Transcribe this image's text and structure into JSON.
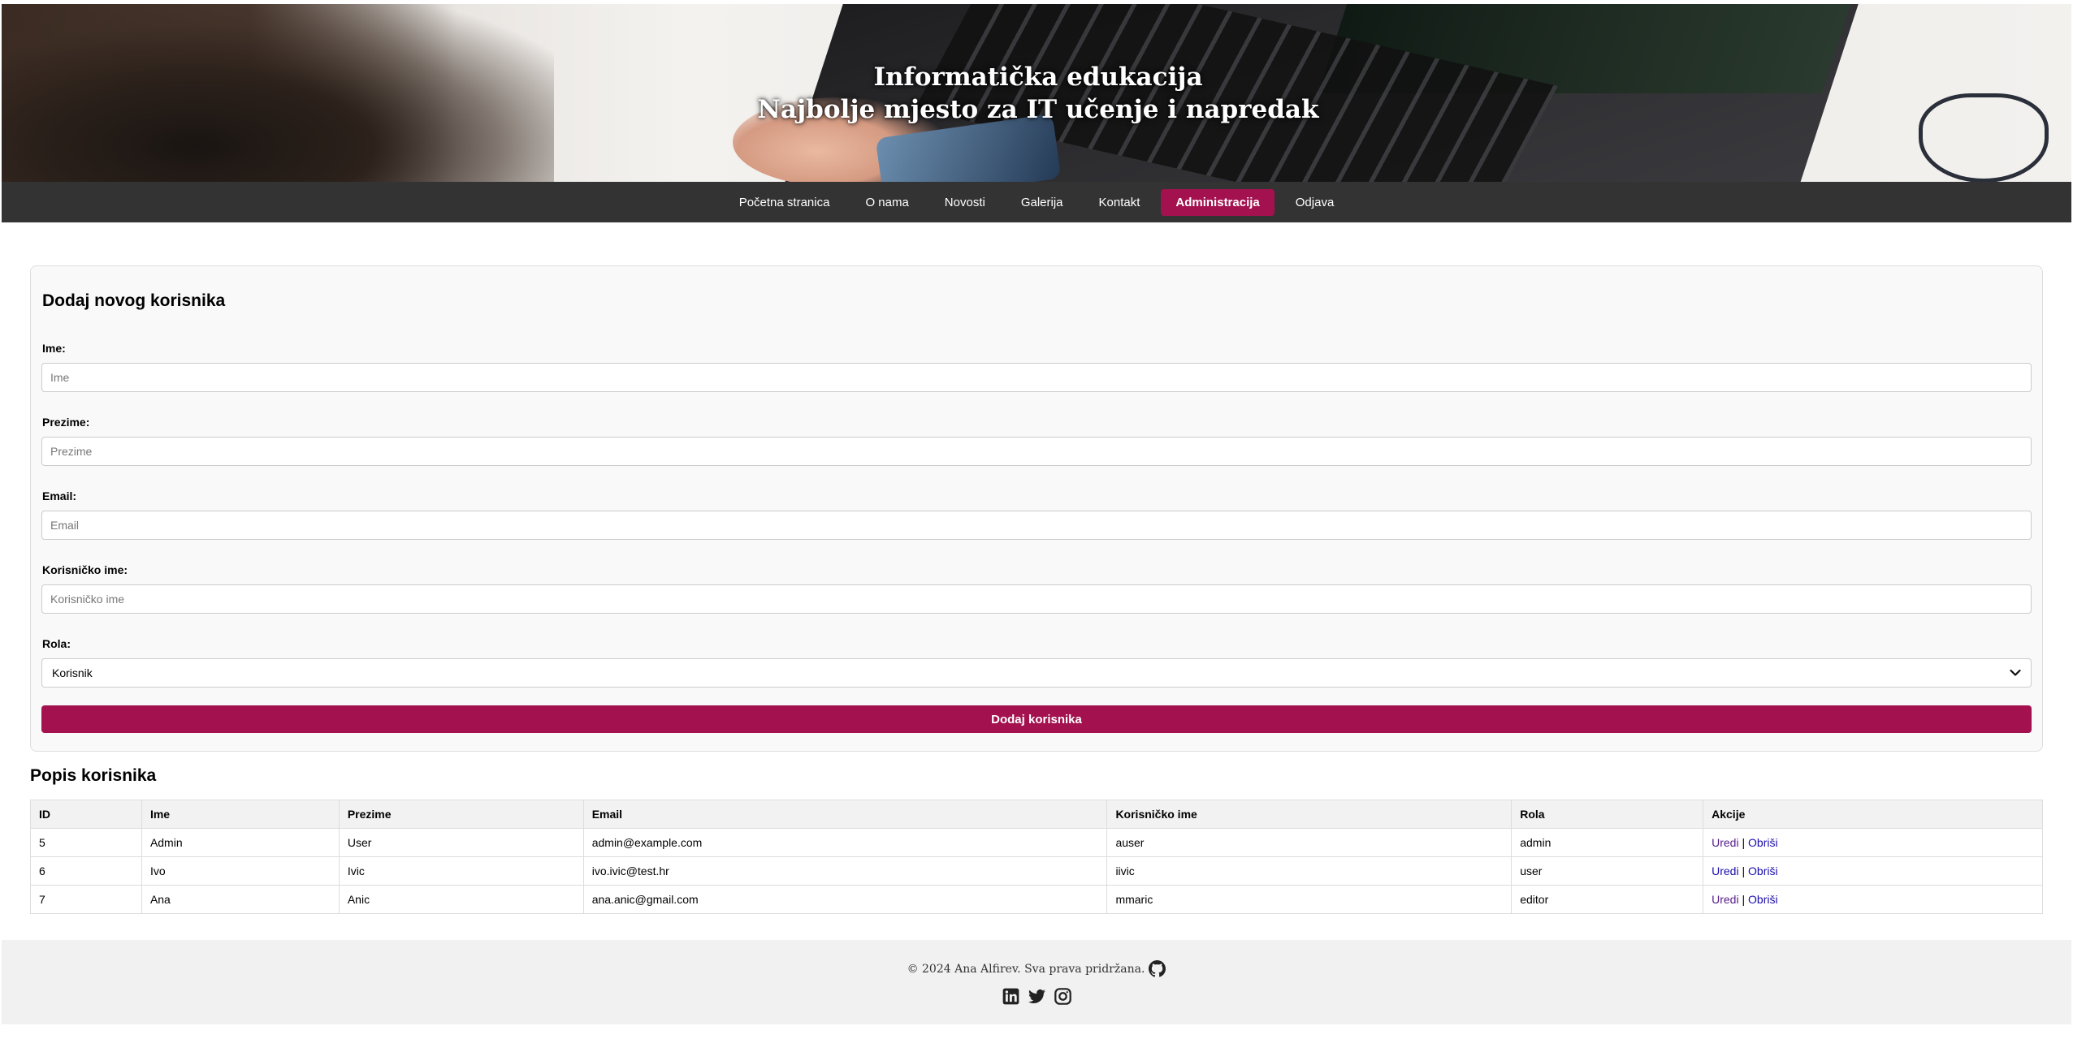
{
  "hero": {
    "title_line1": "Informatička edukacija",
    "title_line2": "Najbolje mjesto za IT učenje i napredak"
  },
  "nav": {
    "items": [
      {
        "label": "Početna stranica"
      },
      {
        "label": "O nama"
      },
      {
        "label": "Novosti"
      },
      {
        "label": "Galerija"
      },
      {
        "label": "Kontakt"
      },
      {
        "label": "Administracija",
        "active": true
      },
      {
        "label": "Odjava"
      }
    ],
    "active_color": "#a3114f"
  },
  "form": {
    "title": "Dodaj novog korisnika",
    "fields": {
      "ime": {
        "label": "Ime:",
        "placeholder": "Ime",
        "value": ""
      },
      "prezime": {
        "label": "Prezime:",
        "placeholder": "Prezime",
        "value": ""
      },
      "email": {
        "label": "Email:",
        "placeholder": "Email",
        "value": ""
      },
      "username": {
        "label": "Korisničko ime:",
        "placeholder": "Korisničko ime",
        "value": ""
      },
      "rola": {
        "label": "Rola:",
        "selected": "Korisnik"
      }
    },
    "submit_label": "Dodaj korisnika",
    "accent_color": "#a3114f"
  },
  "users": {
    "title": "Popis korisnika",
    "columns": [
      "ID",
      "Ime",
      "Prezime",
      "Email",
      "Korisničko ime",
      "Rola",
      "Akcije"
    ],
    "rows": [
      {
        "id": "5",
        "ime": "Admin",
        "prezime": "User",
        "email": "admin@example.com",
        "username": "auser",
        "rola": "admin",
        "edit": "Uredi",
        "sep": "|",
        "delete": "Obriši"
      },
      {
        "id": "6",
        "ime": "Ivo",
        "prezime": "Ivic",
        "email": "ivo.ivic@test.hr",
        "username": "iivic",
        "rola": "user",
        "edit": "Uredi",
        "sep": "|",
        "delete": "Obriši"
      },
      {
        "id": "7",
        "ime": "Ana",
        "prezime": "Anic",
        "email": "ana.anic@gmail.com",
        "username": "mmaric",
        "rola": "editor",
        "edit": "Uredi",
        "sep": "|",
        "delete": "Obriši"
      }
    ]
  },
  "footer": {
    "copyright": "© 2024 Ana Alfirev. Sva prava pridržana.",
    "icons": [
      "github-icon",
      "linkedin-icon",
      "twitter-icon",
      "instagram-icon"
    ]
  }
}
